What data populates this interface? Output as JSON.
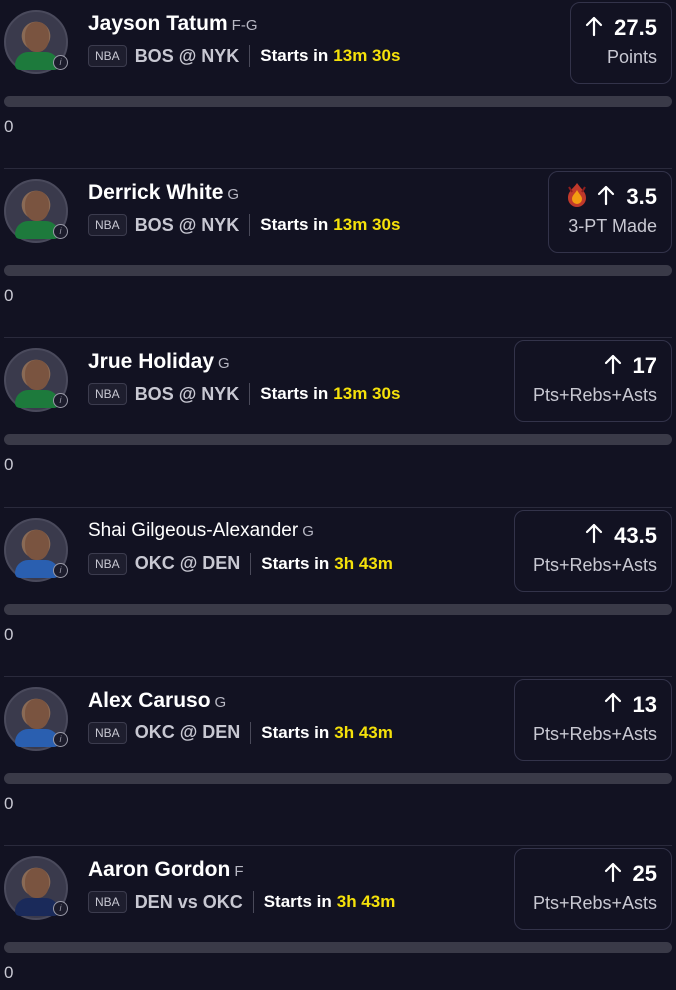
{
  "players": [
    {
      "name": "Jayson Tatum",
      "position": "F-G",
      "league": "NBA",
      "matchup": "BOS @ NYK",
      "starts_label": "Starts in",
      "countdown": "13m 30s",
      "stat_value": "27.5",
      "stat_type": "Points",
      "fire": false,
      "progress_value": "0",
      "progress_fraction": 0,
      "jersey_color": "#1d7a3c",
      "box_width": 102
    },
    {
      "name": "Derrick White",
      "position": "G",
      "league": "NBA",
      "matchup": "BOS @ NYK",
      "starts_label": "Starts in",
      "countdown": "13m 30s",
      "stat_value": "3.5",
      "stat_type": "3-PT Made",
      "fire": true,
      "progress_value": "0",
      "progress_fraction": 0,
      "jersey_color": "#1d7a3c",
      "box_width": 124
    },
    {
      "name": "Jrue Holiday",
      "position": "G",
      "league": "NBA",
      "matchup": "BOS @ NYK",
      "starts_label": "Starts in",
      "countdown": "13m 30s",
      "stat_value": "17",
      "stat_type": "Pts+Rebs+Asts",
      "fire": false,
      "progress_value": "0",
      "progress_fraction": 0,
      "jersey_color": "#1d7a3c",
      "box_width": 158
    },
    {
      "name": "Shai Gilgeous-Alexander",
      "position": "G",
      "league": "NBA",
      "matchup": "OKC @ DEN",
      "starts_label": "Starts in",
      "countdown": "3h 43m",
      "stat_value": "43.5",
      "stat_type": "Pts+Rebs+Asts",
      "fire": false,
      "progress_value": "0",
      "progress_fraction": 0,
      "jersey_color": "#2a5fb0",
      "box_width": 158
    },
    {
      "name": "Alex Caruso",
      "position": "G",
      "league": "NBA",
      "matchup": "OKC @ DEN",
      "starts_label": "Starts in",
      "countdown": "3h 43m",
      "stat_value": "13",
      "stat_type": "Pts+Rebs+Asts",
      "fire": false,
      "progress_value": "0",
      "progress_fraction": 0,
      "jersey_color": "#2a5fb0",
      "box_width": 158
    },
    {
      "name": "Aaron Gordon",
      "position": "F",
      "league": "NBA",
      "matchup": "DEN vs OKC",
      "starts_label": "Starts in",
      "countdown": "3h 43m",
      "stat_value": "25",
      "stat_type": "Pts+Rebs+Asts",
      "fire": false,
      "progress_value": "0",
      "progress_fraction": 0,
      "jersey_color": "#1a2a5a",
      "box_width": 158
    }
  ],
  "colors": {
    "countdown": "#f5e10a",
    "background": "#121222"
  },
  "icons": {
    "arrow": "arrow-up-icon",
    "fire": "fire-demon-icon",
    "info": "info-icon"
  }
}
